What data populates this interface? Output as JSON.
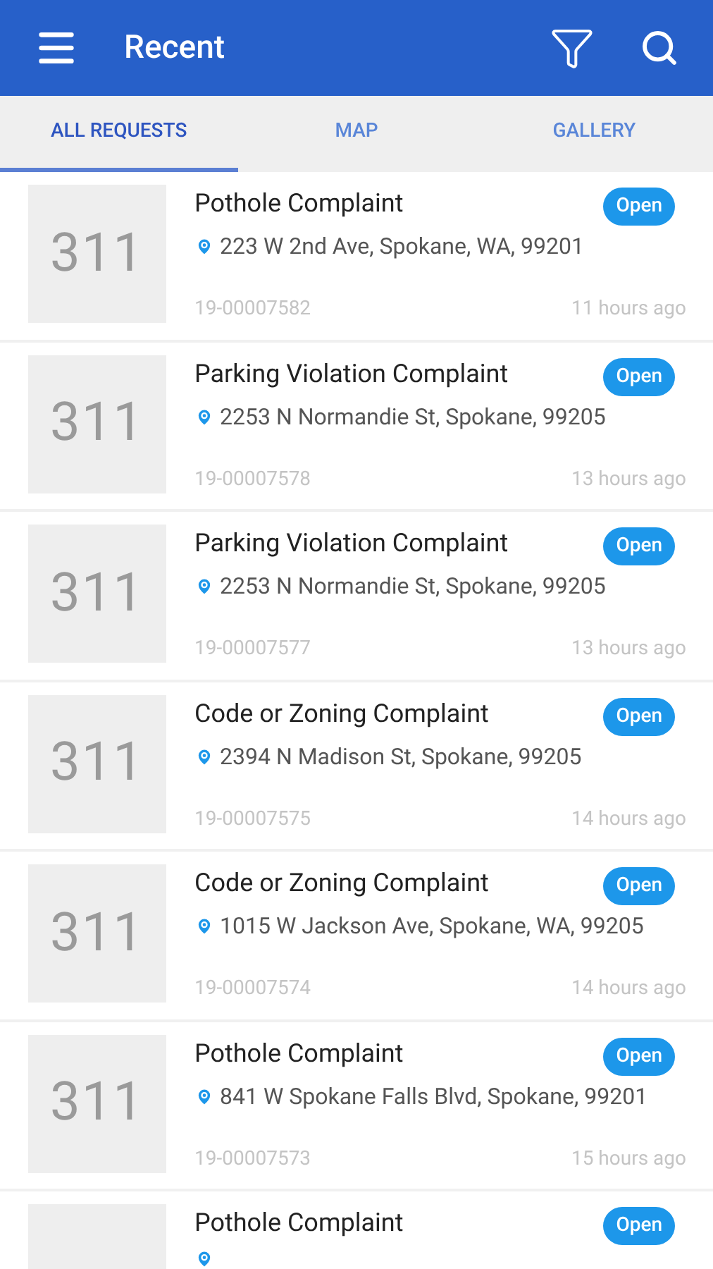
{
  "app_bar": {
    "title": "Recent"
  },
  "tabs": [
    {
      "label": "ALL REQUESTS",
      "selected": true
    },
    {
      "label": "MAP",
      "selected": false
    },
    {
      "label": "GALLERY",
      "selected": false
    }
  ],
  "requests": [
    {
      "thumbnail": "311",
      "title": "Pothole Complaint",
      "status": "Open",
      "address": "223 W 2nd Ave, Spokane, WA, 99201",
      "id": "19-00007582",
      "time": "11 hours ago"
    },
    {
      "thumbnail": "311",
      "title": "Parking Violation Complaint",
      "status": "Open",
      "address": "2253 N Normandie St, Spokane, 99205",
      "id": "19-00007578",
      "time": "13 hours ago"
    },
    {
      "thumbnail": "311",
      "title": "Parking Violation Complaint",
      "status": "Open",
      "address": "2253 N Normandie St, Spokane, 99205",
      "id": "19-00007577",
      "time": "13 hours ago"
    },
    {
      "thumbnail": "311",
      "title": "Code or Zoning Complaint",
      "status": "Open",
      "address": "2394 N Madison St, Spokane, 99205",
      "id": "19-00007575",
      "time": "14 hours ago"
    },
    {
      "thumbnail": "311",
      "title": "Code or Zoning Complaint",
      "status": "Open",
      "address": "1015 W Jackson Ave, Spokane, WA, 99205",
      "id": "19-00007574",
      "time": "14 hours ago"
    },
    {
      "thumbnail": "311",
      "title": "Pothole Complaint",
      "status": "Open",
      "address": "841 W Spokane Falls Blvd, Spokane, 99201",
      "id": "19-00007573",
      "time": "15 hours ago"
    },
    {
      "title": "Pothole Complaint",
      "status": "Open"
    }
  ]
}
